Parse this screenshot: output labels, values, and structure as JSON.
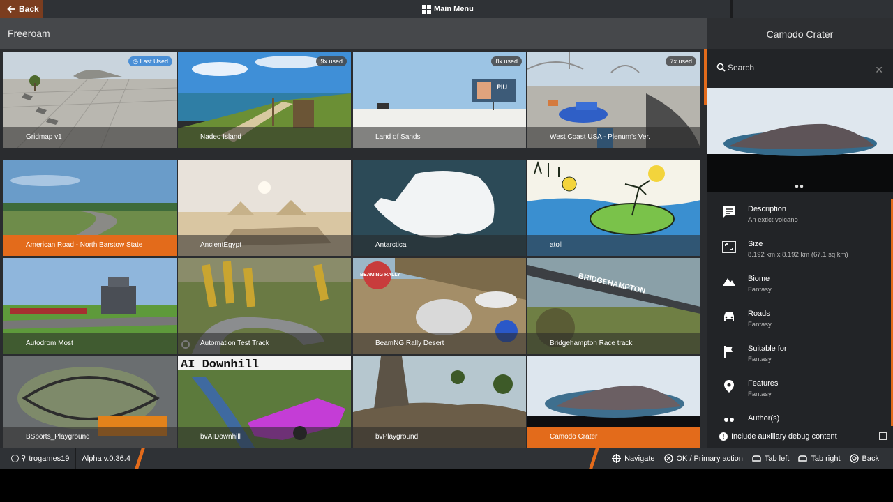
{
  "topbar": {
    "back_label": "Back",
    "center_title": "Main Menu"
  },
  "section": {
    "title": "Freeroam"
  },
  "tiles": [
    {
      "name": "Gridmap v1",
      "badge": "Last Used",
      "badge_style": "blue"
    },
    {
      "name": "Nadeo Island",
      "badge": "9x used"
    },
    {
      "name": "Land of Sands",
      "badge": "8x used"
    },
    {
      "name": "West Coast USA - Plenum's Ver.",
      "badge": "7x used"
    },
    {
      "name": "American Road - North Barstow State",
      "badge": "",
      "selected": true
    },
    {
      "name": "AncientEgypt",
      "badge": ""
    },
    {
      "name": "Antarctica",
      "badge": ""
    },
    {
      "name": "atoll",
      "badge": ""
    },
    {
      "name": "Autodrom Most",
      "badge": ""
    },
    {
      "name": "Automation Test Track",
      "badge": ""
    },
    {
      "name": "BeamNG Rally Desert",
      "badge": ""
    },
    {
      "name": "Bridgehampton Race track",
      "badge": ""
    },
    {
      "name": "BSports_Playground",
      "badge": ""
    },
    {
      "name": "bvAIDownhill",
      "badge": ""
    },
    {
      "name": "bvPlayground",
      "badge": ""
    },
    {
      "name": "Camodo Crater",
      "badge": "",
      "highlight": true
    }
  ],
  "tile_art_text": {
    "aidownhill": "AI Downhill",
    "rally": "BEAMING RALLY",
    "bridge": "BRIDGEHAMPTON",
    "piu": "PIU"
  },
  "panel": {
    "title": "Camodo Crater",
    "search_placeholder": "Search",
    "close_glyph": "✕",
    "carousel_dots": "●●",
    "info": [
      {
        "icon": "description-icon",
        "label": "Description",
        "value": "An extict volcano"
      },
      {
        "icon": "size-icon",
        "label": "Size",
        "value": "8.192 km x 8.192 km (67.1 sq km)"
      },
      {
        "icon": "biome-icon",
        "label": "Biome",
        "value": "Fantasy"
      },
      {
        "icon": "roads-icon",
        "label": "Roads",
        "value": "Fantasy"
      },
      {
        "icon": "flag-icon",
        "label": "Suitable for",
        "value": "Fantasy"
      },
      {
        "icon": "pin-icon",
        "label": "Features",
        "value": "Fantasy"
      },
      {
        "icon": "authors-icon",
        "label": "Author(s)",
        "value": ""
      }
    ],
    "debug_label": "Include auxiliary debug content",
    "debug_checked": false
  },
  "bottombar": {
    "username": "trogames19",
    "version": "Alpha v.0.36.4",
    "hints": [
      {
        "icon": "navigate-icon",
        "label": "Navigate"
      },
      {
        "icon": "ok-icon",
        "label": "OK / Primary action"
      },
      {
        "icon": "tab-left-icon",
        "label": "Tab left"
      },
      {
        "icon": "tab-right-icon",
        "label": "Tab right"
      },
      {
        "icon": "back-icon",
        "label": "Back"
      }
    ]
  },
  "colors": {
    "accent": "#e36b1b",
    "badge_blue": "#4a8fd6",
    "bar_bg": "#2f3236",
    "panel_bg": "#222427"
  }
}
